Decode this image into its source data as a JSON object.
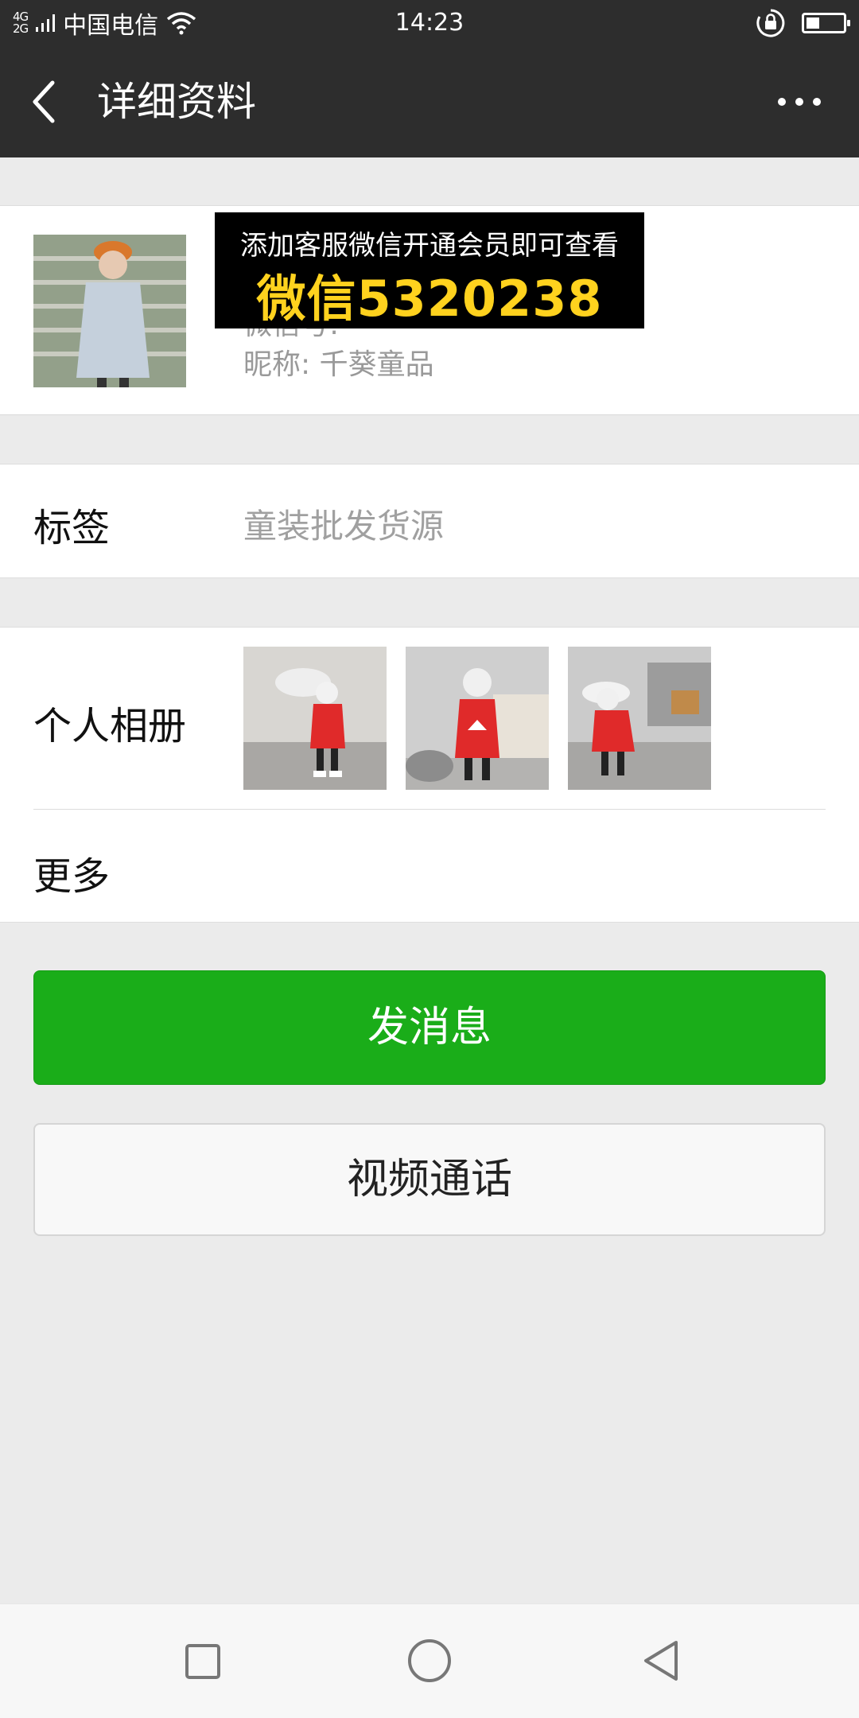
{
  "status_bar": {
    "network_type_top": "4G",
    "network_type_bottom": "2G",
    "carrier": "中国电信",
    "time": "14:23",
    "icons": [
      "signal-icon",
      "wifi-icon",
      "rotation-lock-icon",
      "battery-icon"
    ]
  },
  "nav": {
    "title": "详细资料",
    "back_icon": "back-chevron-icon",
    "more_icon": "more-dots-icon"
  },
  "profile": {
    "wechat_id": "微信号: ",
    "nickname": "昵称: 千葵童品"
  },
  "ad_banner": {
    "line1": "添加客服微信开通会员即可查看",
    "line2": "微信5320238"
  },
  "tag_row": {
    "label": "标签",
    "value": "童装批发货源"
  },
  "album": {
    "label": "个人相册",
    "photos": [
      "photo-1",
      "photo-2",
      "photo-3"
    ]
  },
  "more_row": {
    "label": "更多"
  },
  "buttons": {
    "send_message": "发消息",
    "video_call": "视频通话"
  },
  "colors": {
    "header_bg": "#2d2d2d",
    "page_bg": "#ebebeb",
    "primary_green": "#1aad19",
    "banner_yellow": "#ffd21e"
  }
}
